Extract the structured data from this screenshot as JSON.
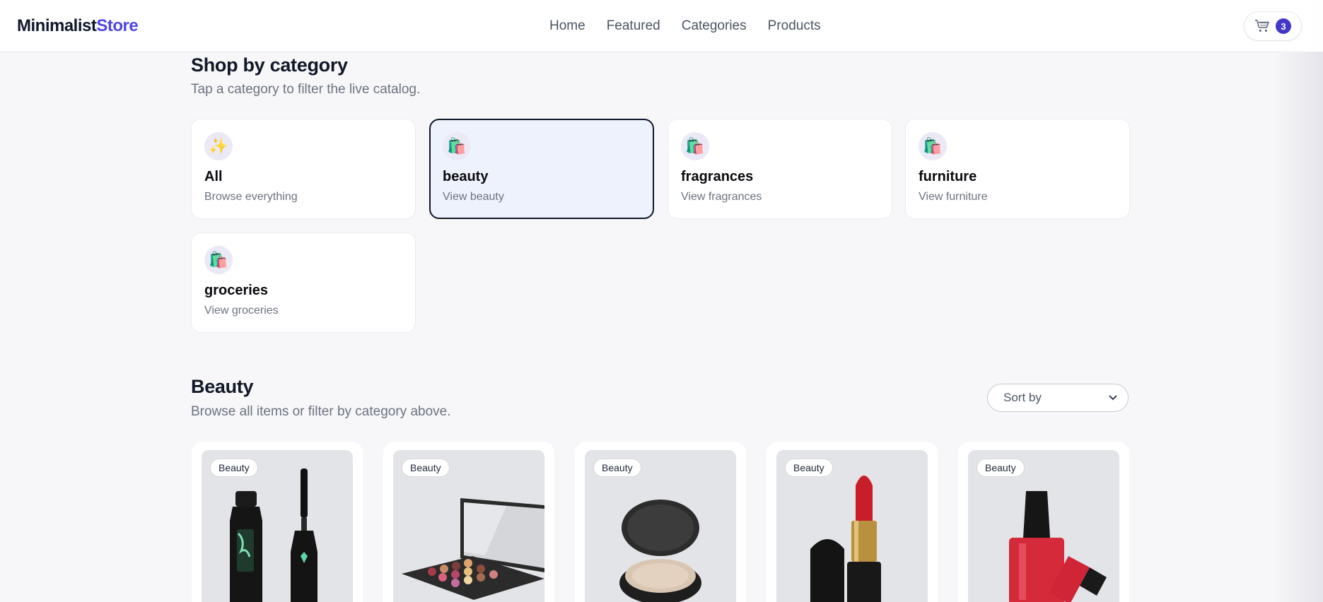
{
  "header": {
    "brand_part1": "Minimalist",
    "brand_part2": "Store",
    "nav": [
      "Home",
      "Featured",
      "Categories",
      "Products"
    ],
    "cart_count": "3"
  },
  "categories_section": {
    "title": "Shop by category",
    "subtitle": "Tap a category to filter the live catalog.",
    "items": [
      {
        "name": "All",
        "desc": "Browse everything",
        "icon": "sparkles-icon",
        "active": false
      },
      {
        "name": "beauty",
        "desc": "View beauty",
        "icon": "shopping-bag-icon",
        "active": true
      },
      {
        "name": "fragrances",
        "desc": "View fragrances",
        "icon": "shopping-bag-icon",
        "active": false
      },
      {
        "name": "furniture",
        "desc": "View furniture",
        "icon": "shopping-bag-icon",
        "active": false
      },
      {
        "name": "groceries",
        "desc": "View groceries",
        "icon": "shopping-bag-icon",
        "active": false
      }
    ]
  },
  "products_section": {
    "title": "Beauty",
    "subtitle": "Browse all items or filter by category above.",
    "sort_placeholder": "Sort by",
    "products": [
      {
        "badge": "Beauty",
        "image": "mascara"
      },
      {
        "badge": "Beauty",
        "image": "eyeshadow-palette"
      },
      {
        "badge": "Beauty",
        "image": "powder-compact"
      },
      {
        "badge": "Beauty",
        "image": "red-lipstick"
      },
      {
        "badge": "Beauty",
        "image": "red-nail-polish"
      }
    ]
  },
  "colors": {
    "accent": "#4f46e5",
    "cart_badge": "#4338ca",
    "active_card_bg": "#eef2fd"
  }
}
